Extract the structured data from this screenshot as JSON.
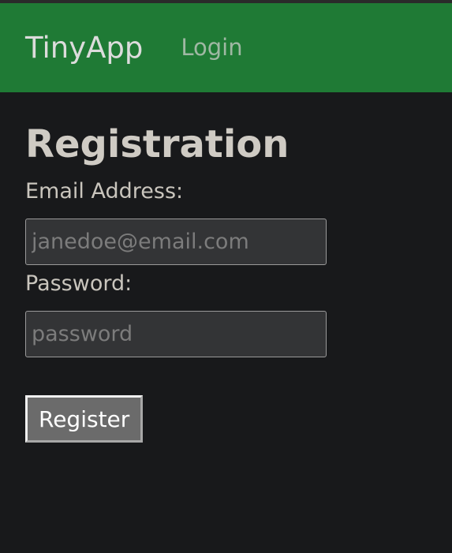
{
  "navbar": {
    "brand": "TinyApp",
    "links": [
      {
        "label": "Login"
      }
    ],
    "color": "#1f7a35"
  },
  "page": {
    "title": "Registration",
    "background": "#18191b"
  },
  "form": {
    "email_label": "Email Address:",
    "email_placeholder": "janedoe@email.com",
    "email_value": "",
    "password_label": "Password:",
    "password_placeholder": "password",
    "password_value": "",
    "submit_label": "Register"
  }
}
